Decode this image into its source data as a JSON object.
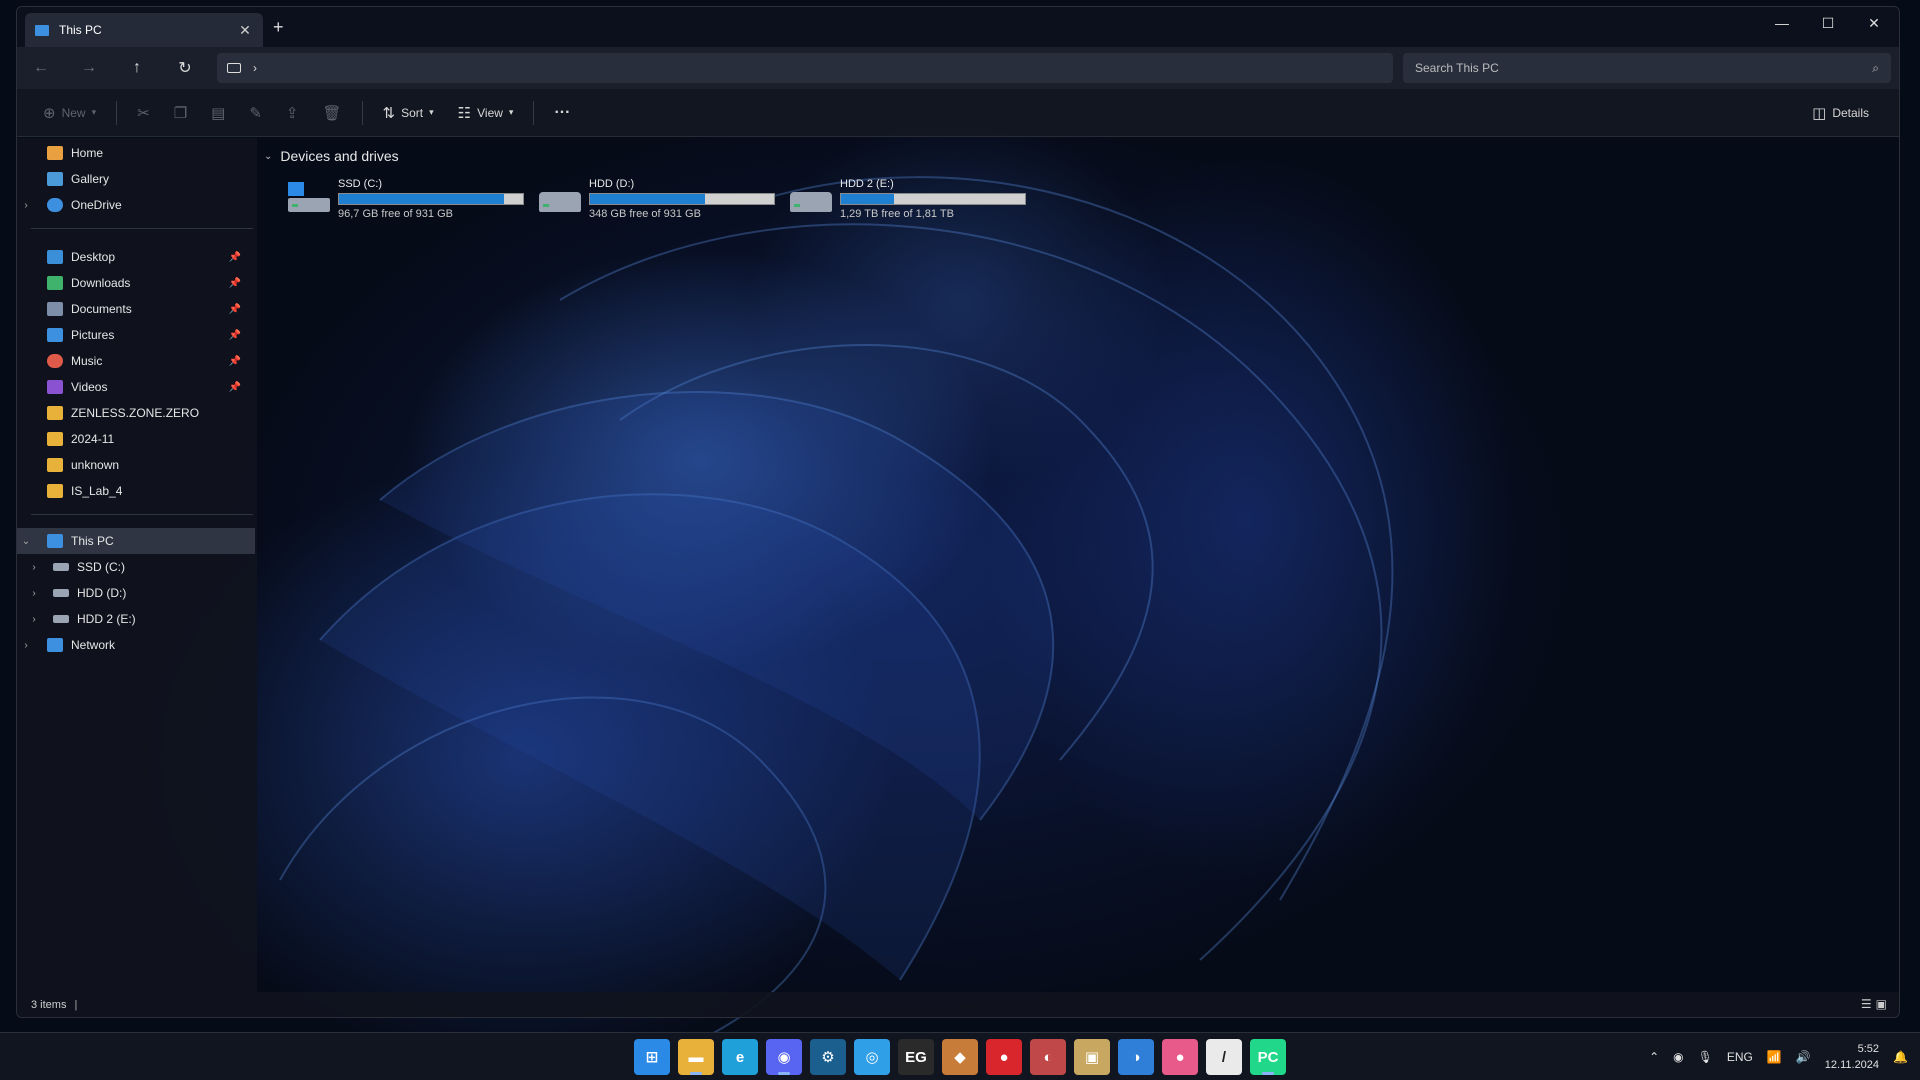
{
  "window": {
    "tab_title": "This PC",
    "tab_close": "✕",
    "new_tab": "+",
    "controls": {
      "minimize": "—",
      "maximize": "☐",
      "close": "✕"
    }
  },
  "navbar": {
    "address_separator": "›",
    "search_placeholder": "Search This PC"
  },
  "toolbar": {
    "new_label": "New",
    "sort_label": "Sort",
    "view_label": "View",
    "more_label": "···",
    "details_label": "Details"
  },
  "sidebar": {
    "items": [
      {
        "label": "Home",
        "icon": "home-icon",
        "color": "#e8a040"
      },
      {
        "label": "Gallery",
        "icon": "gallery-icon",
        "color": "#4a9bd8"
      },
      {
        "label": "OneDrive",
        "icon": "cloud-icon",
        "color": "#3d8fe0"
      },
      {
        "label": "Desktop",
        "icon": "desktop-icon",
        "color": "#3a8fd8"
      },
      {
        "label": "Downloads",
        "icon": "download-icon",
        "color": "#3fb36b"
      },
      {
        "label": "Documents",
        "icon": "document-icon",
        "color": "#7d8ea8"
      },
      {
        "label": "Pictures",
        "icon": "pictures-icon",
        "color": "#3d8fe0"
      },
      {
        "label": "Music",
        "icon": "music-icon",
        "color": "#e05a4a"
      },
      {
        "label": "Videos",
        "icon": "video-icon",
        "color": "#8a52d0"
      },
      {
        "label": "ZENLESS.ZONE.ZERO",
        "icon": "folder-icon",
        "color": "#e8b23a"
      },
      {
        "label": "2024-11",
        "icon": "folder-icon",
        "color": "#e8b23a"
      },
      {
        "label": "unknown",
        "icon": "folder-icon",
        "color": "#e8b23a"
      },
      {
        "label": "IS_Lab_4",
        "icon": "folder-icon",
        "color": "#e8b23a"
      },
      {
        "label": "This PC",
        "icon": "pc-icon",
        "color": "#3d8fe0"
      },
      {
        "label": "SSD (C:)",
        "icon": "drive-icon",
        "color": "#9aa4b2"
      },
      {
        "label": "HDD (D:)",
        "icon": "drive-icon",
        "color": "#9aa4b2"
      },
      {
        "label": "HDD 2 (E:)",
        "icon": "drive-icon",
        "color": "#9aa4b2"
      },
      {
        "label": "Network",
        "icon": "network-icon",
        "color": "#3d8fe0"
      }
    ]
  },
  "content": {
    "group_title": "Devices and drives",
    "drives": [
      {
        "name": "SSD (C:)",
        "free_text": "96,7 GB free of 931 GB",
        "used_fraction": 0.896
      },
      {
        "name": "HDD (D:)",
        "free_text": "348 GB free of 931 GB",
        "used_fraction": 0.626
      },
      {
        "name": "HDD 2 (E:)",
        "free_text": "1,29 TB free of 1,81 TB",
        "used_fraction": 0.287
      }
    ]
  },
  "status": {
    "items_count": "3 items"
  },
  "taskbar": {
    "apps": [
      {
        "name": "start-button",
        "glyph": "⊞",
        "color": "#2b8ae6"
      },
      {
        "name": "file-explorer",
        "glyph": "▬",
        "color": "#e8b23a"
      },
      {
        "name": "edge",
        "glyph": "e",
        "color": "#1fa0d8"
      },
      {
        "name": "discord",
        "glyph": "◉",
        "color": "#5865f2"
      },
      {
        "name": "steam",
        "glyph": "⚙",
        "color": "#1b5f8f"
      },
      {
        "name": "app-blue",
        "glyph": "◎",
        "color": "#2f9fe8"
      },
      {
        "name": "epic-games",
        "glyph": "EG",
        "color": "#2a2a2a"
      },
      {
        "name": "app-cube",
        "glyph": "◆",
        "color": "#c87c3a"
      },
      {
        "name": "app-red",
        "glyph": "●",
        "color": "#d8262c"
      },
      {
        "name": "app-game",
        "glyph": "◐",
        "color": "#c04848"
      },
      {
        "name": "app-art",
        "glyph": "▣",
        "color": "#c8a860"
      },
      {
        "name": "app-hoyo",
        "glyph": "◑",
        "color": "#2f7fd8"
      },
      {
        "name": "app-pink",
        "glyph": "●",
        "color": "#e85a8a"
      },
      {
        "name": "app-note",
        "glyph": "/",
        "color": "#eaeaea"
      },
      {
        "name": "pycharm",
        "glyph": "PC",
        "color": "#21d789"
      }
    ],
    "tray": {
      "lang": "ENG",
      "time": "5:52",
      "date": "12.11.2024"
    }
  }
}
